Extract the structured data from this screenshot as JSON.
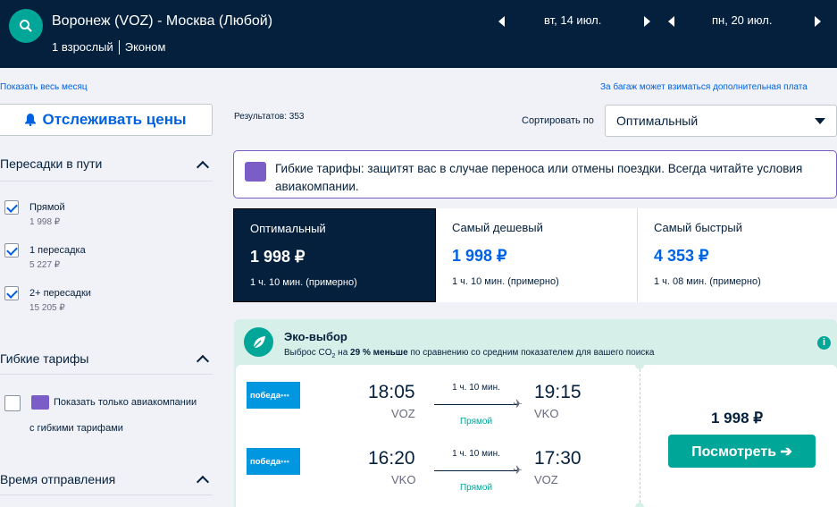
{
  "header": {
    "route": "Воронеж (VOZ) - Москва (Любой)",
    "passengers": "1 взрослый",
    "cabin": "Эконом",
    "depart_date": "вт, 14 июл.",
    "return_date": "пн, 20 июл."
  },
  "links": {
    "whole_month": "Показать весь месяц",
    "baggage_note": "За багаж может взиматься дополнительная плата"
  },
  "sidebar": {
    "track_prices": "Отслеживать цены",
    "stops_title": "Пересадки в пути",
    "stops": [
      {
        "label": "Прямой",
        "price": "1 998 ₽",
        "checked": true
      },
      {
        "label": "1 пересадка",
        "price": "5 227 ₽",
        "checked": true
      },
      {
        "label": "2+ пересадки",
        "price": "15 205 ₽",
        "checked": true
      }
    ],
    "flex_title": "Гибкие тарифы",
    "flex_option_line1": "Показать только авиакомпании",
    "flex_option_line2": "с гибкими тарифами",
    "departure_title": "Время отправления"
  },
  "results": {
    "count": "Результатов: 353",
    "sort_label": "Сортировать по",
    "sort_value": "Оптимальный"
  },
  "flex_banner": {
    "text": "Гибкие тарифы: защитят вас в случае переноса или отмены поездки. Всегда читайте условия авиакомпании."
  },
  "sort_tabs": [
    {
      "name": "Оптимальный",
      "price": "1 998 ₽",
      "duration": "1 ч. 10 мин. (примерно)"
    },
    {
      "name": "Самый дешевый",
      "price": "1 998 ₽",
      "duration": "1 ч. 10 мин. (примерно)"
    },
    {
      "name": "Самый быстрый",
      "price": "4 353 ₽",
      "duration": "1 ч. 08 мин. (примерно)"
    }
  ],
  "eco": {
    "title": "Эко-выбор",
    "sub_prefix": "Выброс CO",
    "sub_subscript": "2",
    "sub_mid": " на ",
    "sub_bold": "29 % меньше",
    "sub_suffix": " по сравнению со средним показателем для вашего поиска"
  },
  "flight": {
    "price": "1 998 ₽",
    "button": "Посмотреть ➔",
    "legs": [
      {
        "airline": "победа",
        "dep_time": "18:05",
        "dep_code": "VOZ",
        "duration": "1 ч. 10 мин.",
        "stops": "Прямой",
        "arr_time": "19:15",
        "arr_code": "VKO"
      },
      {
        "airline": "победа",
        "dep_time": "16:20",
        "dep_code": "VKO",
        "duration": "1 ч. 10 мин.",
        "stops": "Прямой",
        "arr_time": "17:30",
        "arr_code": "VOZ"
      }
    ]
  },
  "colors": {
    "navy": "#05203c",
    "teal": "#00a698",
    "blue": "#0062e3",
    "purple": "#7a5dc7"
  }
}
